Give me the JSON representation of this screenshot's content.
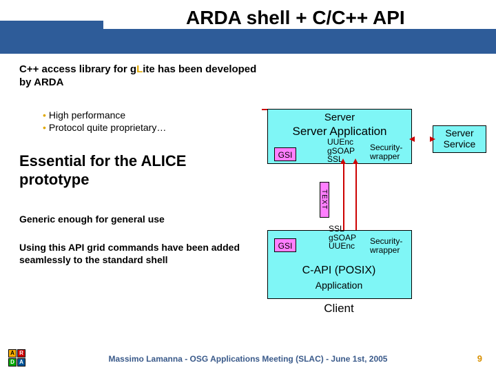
{
  "title": "ARDA shell + C/C++ API",
  "lead_pre": "C++ access library for g",
  "lead_hi": "L",
  "lead_post": "ite has been developed by ARDA",
  "bullet1": "High performance",
  "bullet2": "Protocol quite proprietary…",
  "essential": "Essential for the ALICE prototype",
  "generic": "Generic enough for general use",
  "using": "Using this API grid commands have been added seamlessly to the standard shell",
  "diagram": {
    "server": "Server",
    "server_app": "Server Application",
    "service": "Server Service",
    "gsi": "GSI",
    "uu1": "UUEnc\ngSOAP\nSSL",
    "sec": "Security-\nwrapper",
    "text": "TEXT",
    "ssl2": "SSL\ngSOAP\nUUEnc",
    "capi": "C-API (POSIX)",
    "appl": "Application",
    "client": "Client"
  },
  "footer": "Massimo Lamanna - OSG Applications Meeting (SLAC) - June 1st, 2005",
  "page": "9",
  "logo": {
    "a": "A",
    "r": "R",
    "d": "D",
    "a2": "A"
  }
}
